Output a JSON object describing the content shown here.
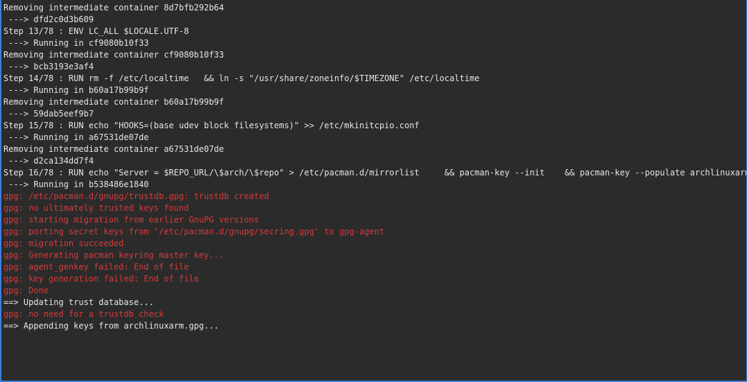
{
  "colors": {
    "background": "#2b2b2b",
    "text": "#e6e6e6",
    "error_text": "#d63a3a",
    "window_border": "#3d7fdc"
  },
  "terminal": {
    "lines": [
      {
        "text": "Removing intermediate container 8d7bfb292b64",
        "kind": "normal"
      },
      {
        "text": " ---> dfd2c0d3b609",
        "kind": "normal"
      },
      {
        "text": "Step 13/78 : ENV LC_ALL $LOCALE.UTF-8",
        "kind": "normal"
      },
      {
        "text": " ---> Running in cf9080b10f33",
        "kind": "normal"
      },
      {
        "text": "Removing intermediate container cf9080b10f33",
        "kind": "normal"
      },
      {
        "text": " ---> bcb3193e3af4",
        "kind": "normal"
      },
      {
        "text": "Step 14/78 : RUN rm -f /etc/localtime   && ln -s \"/usr/share/zoneinfo/$TIMEZONE\" /etc/localtime",
        "kind": "normal"
      },
      {
        "text": " ---> Running in b60a17b99b9f",
        "kind": "normal"
      },
      {
        "text": "Removing intermediate container b60a17b99b9f",
        "kind": "normal"
      },
      {
        "text": " ---> 59dab5eef9b7",
        "kind": "normal"
      },
      {
        "text": "Step 15/78 : RUN echo \"HOOKS=(base udev block filesystems)\" >> /etc/mkinitcpio.conf",
        "kind": "normal"
      },
      {
        "text": " ---> Running in a67531de07de",
        "kind": "normal"
      },
      {
        "text": "Removing intermediate container a67531de07de",
        "kind": "normal"
      },
      {
        "text": " ---> d2ca134dd7f4",
        "kind": "normal"
      },
      {
        "text": "Step 16/78 : RUN echo \"Server = $REPO_URL/\\$arch/\\$repo\" > /etc/pacman.d/mirrorlist     && pacman-key --init    && pacman-key --populate archlinuxarm",
        "kind": "normal"
      },
      {
        "text": " ---> Running in b538486e1840",
        "kind": "normal"
      },
      {
        "text": "gpg: /etc/pacman.d/gnupg/trustdb.gpg: trustdb created",
        "kind": "error"
      },
      {
        "text": "gpg: no ultimately trusted keys found",
        "kind": "error"
      },
      {
        "text": "gpg: starting migration from earlier GnuPG versions",
        "kind": "error"
      },
      {
        "text": "gpg: porting secret keys from '/etc/pacman.d/gnupg/secring.gpg' to gpg-agent",
        "kind": "error"
      },
      {
        "text": "gpg: migration succeeded",
        "kind": "error"
      },
      {
        "text": "gpg: Generating pacman keyring master key...",
        "kind": "error"
      },
      {
        "text": "gpg: agent_genkey failed: End of file",
        "kind": "error"
      },
      {
        "text": "gpg: key generation failed: End of file",
        "kind": "error"
      },
      {
        "text": "gpg: Done",
        "kind": "error"
      },
      {
        "text": "==> Updating trust database...",
        "kind": "normal"
      },
      {
        "text": "gpg: no need for a trustdb check",
        "kind": "error"
      },
      {
        "text": "==> Appending keys from archlinuxarm.gpg...",
        "kind": "normal"
      }
    ]
  }
}
